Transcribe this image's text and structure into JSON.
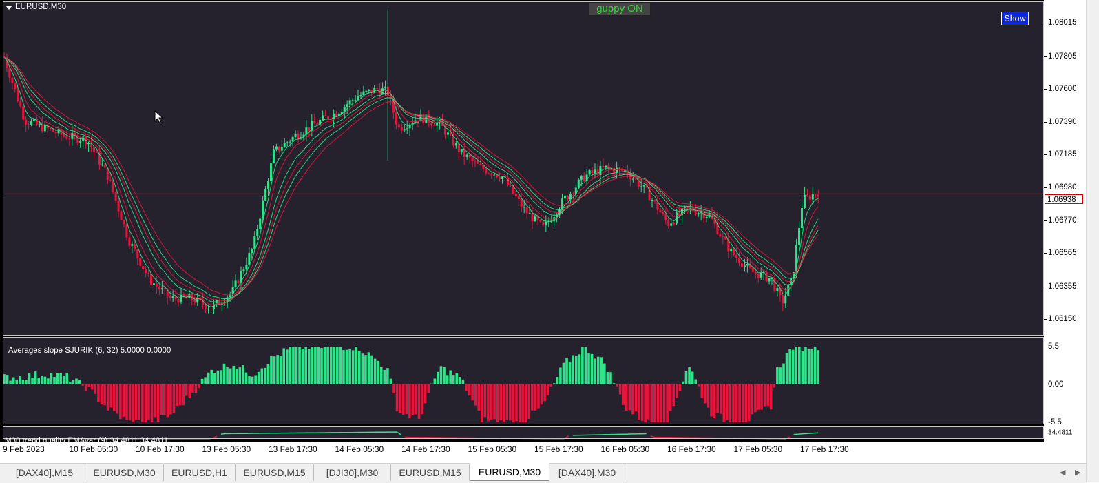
{
  "chart": {
    "symbol_title": "EURUSD,M30",
    "current_price": "1.06938",
    "guppy_label": "guppy ON",
    "show_label": "Show",
    "colors": {
      "bull": "#2ee68a",
      "bear": "#e8143c",
      "background": "#25222e",
      "price_line": "#ff1a1a",
      "guppy_text": "#3bd43b",
      "show_button": "#0b27e0"
    }
  },
  "price_axis": [
    "1.08015",
    "1.07805",
    "1.07600",
    "1.07390",
    "1.07185",
    "1.06980",
    "1.06770",
    "1.06565",
    "1.06355",
    "1.06150"
  ],
  "indicator": {
    "title": "Averages slope  SJURIK (6, 32) 5.0000 0.0000",
    "axis_labels": [
      "5.5",
      "0.00",
      "-5.5"
    ]
  },
  "trend": {
    "title": "M30 trend quality  EMAvar (9) 34.4811 34.4811",
    "axis_label": "34.4811"
  },
  "time_axis": [
    "9 Feb 2023",
    "10 Feb 05:30",
    "10 Feb 17:30",
    "13 Feb 05:30",
    "13 Feb 17:30",
    "14 Feb 05:30",
    "14 Feb 17:30",
    "15 Feb 05:30",
    "15 Feb 17:30",
    "16 Feb 05:30",
    "16 Feb 17:30",
    "17 Feb 05:30",
    "17 Feb 17:30"
  ],
  "tabs": [
    {
      "label": "[DAX40],M15",
      "active": false
    },
    {
      "label": "EURUSD,M30",
      "active": false
    },
    {
      "label": "EURUSD,H1",
      "active": false
    },
    {
      "label": "EURUSD,M15",
      "active": false
    },
    {
      "label": "[DJI30],M30",
      "active": false
    },
    {
      "label": "EURUSD,M15",
      "active": false
    },
    {
      "label": "EURUSD,M30",
      "active": true
    },
    {
      "label": "[DAX40],M30",
      "active": false
    }
  ],
  "chart_data": {
    "type": "candlestick",
    "title": "EURUSD,M30",
    "ylim": [
      1.0605,
      1.0815
    ],
    "close_path": [
      [
        0,
        1.078
      ],
      [
        0.02,
        1.074
      ],
      [
        0.04,
        1.0735
      ],
      [
        0.06,
        1.073
      ],
      [
        0.08,
        1.0728
      ],
      [
        0.1,
        1.0705
      ],
      [
        0.12,
        1.0665
      ],
      [
        0.14,
        1.064
      ],
      [
        0.16,
        1.0628
      ],
      [
        0.18,
        1.0628
      ],
      [
        0.2,
        1.0622
      ],
      [
        0.22,
        1.0632
      ],
      [
        0.24,
        1.066
      ],
      [
        0.26,
        1.072
      ],
      [
        0.28,
        1.073
      ],
      [
        0.3,
        1.0738
      ],
      [
        0.32,
        1.0745
      ],
      [
        0.34,
        1.0755
      ],
      [
        0.36,
        1.076
      ],
      [
        0.37,
        1.0758
      ],
      [
        0.38,
        1.0735
      ],
      [
        0.4,
        1.0742
      ],
      [
        0.42,
        1.0738
      ],
      [
        0.44,
        1.072
      ],
      [
        0.46,
        1.071
      ],
      [
        0.48,
        1.0705
      ],
      [
        0.5,
        1.0685
      ],
      [
        0.52,
        1.0672
      ],
      [
        0.54,
        1.069
      ],
      [
        0.56,
        1.0705
      ],
      [
        0.58,
        1.071
      ],
      [
        0.6,
        1.0708
      ],
      [
        0.62,
        1.0695
      ],
      [
        0.64,
        1.0675
      ],
      [
        0.66,
        1.0685
      ],
      [
        0.68,
        1.068
      ],
      [
        0.7,
        1.0658
      ],
      [
        0.72,
        1.0645
      ],
      [
        0.74,
        1.064
      ],
      [
        0.75,
        1.0625
      ],
      [
        0.76,
        1.064
      ],
      [
        0.77,
        1.069
      ],
      [
        0.785,
        1.0695
      ]
    ],
    "slope_bars": [
      [
        0,
        1
      ],
      [
        0.02,
        1.2
      ],
      [
        0.04,
        1.5
      ],
      [
        0.06,
        1.2
      ],
      [
        0.08,
        -0.5
      ],
      [
        0.1,
        -3.5
      ],
      [
        0.12,
        -5.5
      ],
      [
        0.14,
        -5.5
      ],
      [
        0.16,
        -4.5
      ],
      [
        0.18,
        -1.5
      ],
      [
        0.2,
        2
      ],
      [
        0.22,
        3
      ],
      [
        0.24,
        1.5
      ],
      [
        0.26,
        4
      ],
      [
        0.28,
        5.5
      ],
      [
        0.3,
        5.5
      ],
      [
        0.32,
        5.5
      ],
      [
        0.34,
        5.5
      ],
      [
        0.36,
        3.5
      ],
      [
        0.37,
        2
      ],
      [
        0.38,
        -4
      ],
      [
        0.4,
        -5
      ],
      [
        0.42,
        2.5
      ],
      [
        0.44,
        1
      ],
      [
        0.46,
        -5
      ],
      [
        0.48,
        -5.5
      ],
      [
        0.5,
        -5.5
      ],
      [
        0.52,
        -3
      ],
      [
        0.54,
        3
      ],
      [
        0.56,
        5.5
      ],
      [
        0.58,
        3
      ],
      [
        0.6,
        -3.5
      ],
      [
        0.62,
        -5.5
      ],
      [
        0.64,
        -5.5
      ],
      [
        0.66,
        3
      ],
      [
        0.68,
        -4
      ],
      [
        0.7,
        -5.5
      ],
      [
        0.72,
        -5
      ],
      [
        0.74,
        -3
      ],
      [
        0.745,
        2
      ],
      [
        0.76,
        5.5
      ],
      [
        0.785,
        5.5
      ]
    ],
    "trend_quality": [
      [
        0,
        -2
      ],
      [
        0.2,
        -2
      ],
      [
        0.21,
        1
      ],
      [
        0.38,
        2
      ],
      [
        0.385,
        -1
      ],
      [
        0.54,
        -2
      ],
      [
        0.545,
        0
      ],
      [
        0.62,
        1
      ],
      [
        0.625,
        -1
      ],
      [
        0.755,
        -2
      ],
      [
        0.76,
        0.5
      ],
      [
        0.785,
        1.5
      ]
    ]
  }
}
